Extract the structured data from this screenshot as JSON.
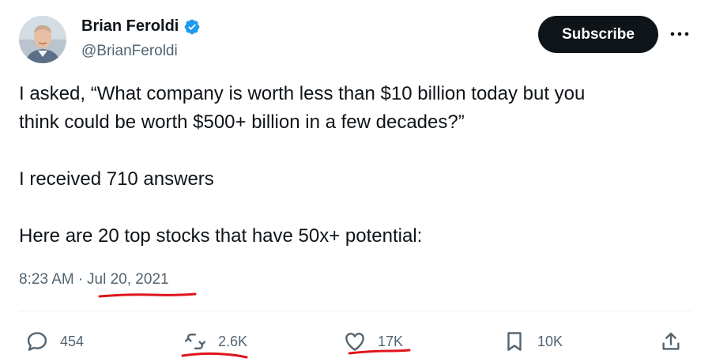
{
  "author": {
    "name": "Brian Feroldi",
    "handle": "@BrianFeroldi",
    "verified": true
  },
  "header": {
    "subscribe_label": "Subscribe",
    "more_icon": "more-horizontal-icon"
  },
  "tweet": {
    "lines": [
      "I asked, “What company is worth less than $10 billion today but you",
      "think could be worth $500+ billion in a few decades?”",
      "I received 710 answers",
      "Here are 20 top stocks that have 50x+ potential:"
    ]
  },
  "meta": {
    "time": "8:23 AM",
    "separator": "·",
    "date": "Jul 20, 2021"
  },
  "actions": {
    "replies": "454",
    "reposts": "2.6K",
    "likes": "17K",
    "bookmarks": "10K"
  },
  "colors": {
    "text": "#0f1419",
    "secondary": "#536471",
    "verified": "#1d9bf0",
    "subscribe_bg": "#0f1419",
    "annotation": "#e0141c"
  }
}
